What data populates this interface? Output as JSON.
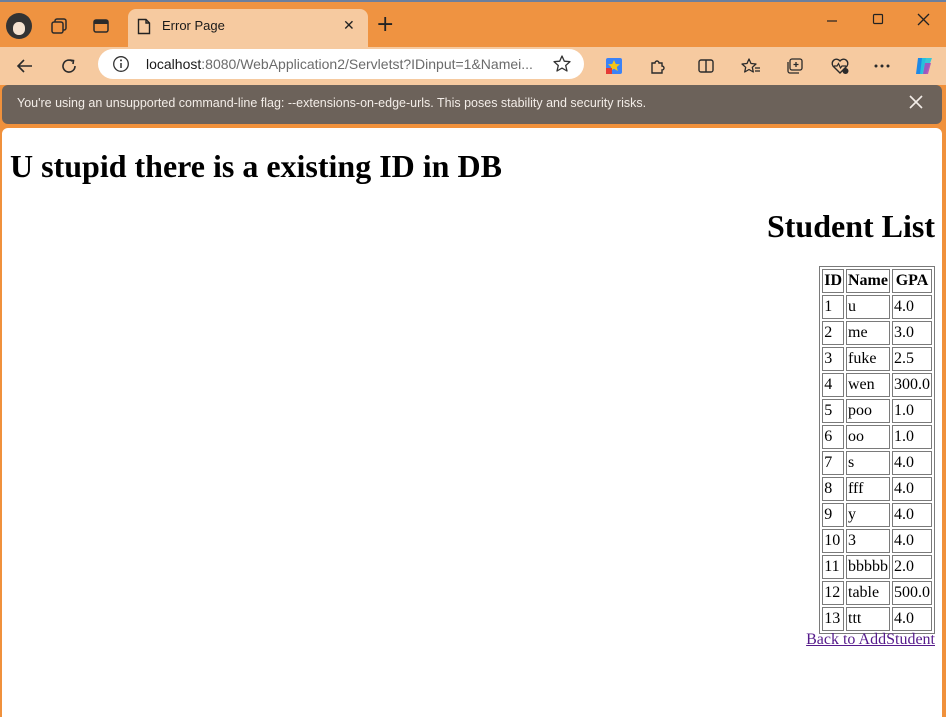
{
  "browser": {
    "tab": {
      "title": "Error Page"
    },
    "address": {
      "host": "localhost",
      "rest": ":8080/WebApplication2/Servletst?IDinput=1&Namei..."
    },
    "infobar": {
      "message": "You're using an unsupported command-line flag: --extensions-on-edge-urls. This poses stability and security risks."
    },
    "icons": [
      "profile-avatar",
      "workspaces-icon",
      "tab-actions-icon",
      "page-icon",
      "close-icon",
      "new-tab-icon",
      "minimize-icon",
      "maximize-icon",
      "window-close-icon",
      "back-icon",
      "refresh-icon",
      "info-icon",
      "favorite-star-icon",
      "extension-colorful-icon",
      "extensions-icon",
      "split-screen-icon",
      "favorites-icon",
      "collections-icon",
      "browser-essentials-icon",
      "more-icon",
      "copilot-icon"
    ],
    "accent": "#ef9341"
  },
  "page": {
    "heading": "U stupid there is a existing ID in DB",
    "list_title": "Student List",
    "columns": [
      "ID",
      "Name",
      "GPA"
    ],
    "rows": [
      [
        "1",
        "u",
        "4.0"
      ],
      [
        "2",
        "me",
        "3.0"
      ],
      [
        "3",
        "fuke",
        "2.5"
      ],
      [
        "4",
        "wen",
        "300.0"
      ],
      [
        "5",
        "poo",
        "1.0"
      ],
      [
        "6",
        "oo",
        "1.0"
      ],
      [
        "7",
        "s",
        "4.0"
      ],
      [
        "8",
        "fff",
        "4.0"
      ],
      [
        "9",
        "y",
        "4.0"
      ],
      [
        "10",
        "3",
        "4.0"
      ],
      [
        "11",
        "bbbbb",
        "2.0"
      ],
      [
        "12",
        "table",
        "500.0"
      ],
      [
        "13",
        "ttt",
        "4.0"
      ]
    ],
    "back_link": "Back to AddStudent"
  }
}
